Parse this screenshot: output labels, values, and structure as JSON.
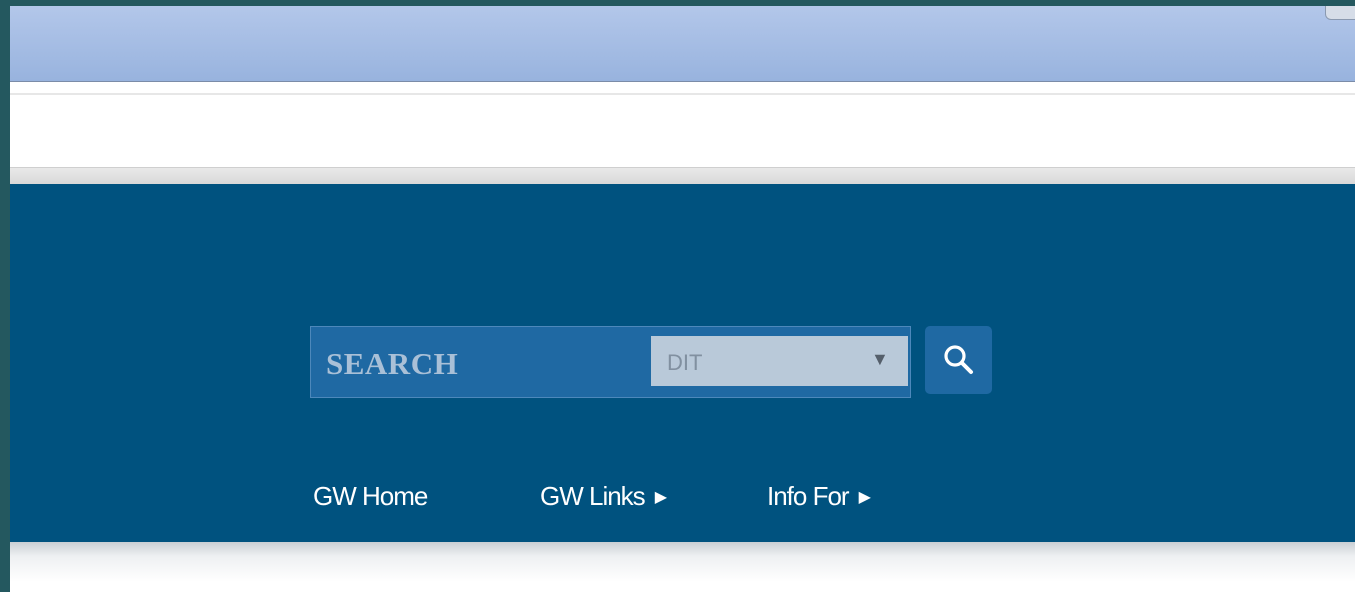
{
  "search": {
    "label": "SEARCH",
    "scope_selected": "DIT",
    "caret": "▼",
    "button_icon": "search-icon"
  },
  "nav": {
    "items": [
      {
        "label": "GW Home",
        "arrow": ""
      },
      {
        "label": "GW Links",
        "arrow": "▶"
      },
      {
        "label": "Info For",
        "arrow": "▶"
      }
    ]
  },
  "colors": {
    "header_bg": "#00527f",
    "search_bg": "#1f69a3",
    "scope_bg": "#b9c9d9",
    "titlebar": "#a8bfe6",
    "desktop": "#24585f"
  }
}
